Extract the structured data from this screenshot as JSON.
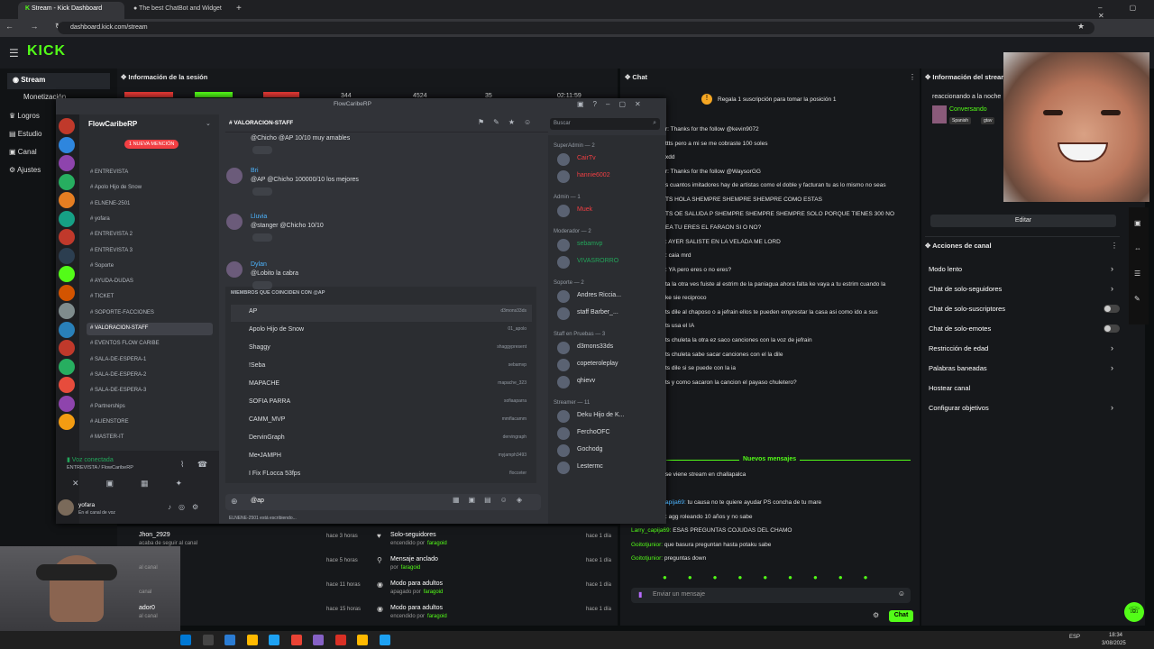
{
  "browser": {
    "tabs": [
      "Stream - Kick Dashboard",
      "The best ChatBot and Widget"
    ],
    "url": "dashboard.kick.com/stream"
  },
  "kick": {
    "logo": "KICK",
    "nav": [
      "Stream",
      "Monetización",
      "Logros",
      "Estudio",
      "Canal",
      "Ajustes"
    ],
    "session_title": "Información de la sesión",
    "stats": [
      "344",
      "4524",
      "35",
      "02:11:59"
    ],
    "chat_title": "Chat",
    "stream_info_title": "Información del stream",
    "accent": "#53fc18"
  },
  "discord": {
    "title": "FlowCaribeRP",
    "server": "FlowCaribeRP",
    "channel_header": "VALORACION-STAFF",
    "search_placeholder": "Buscar",
    "new_mention": "1 NUEVA MENCIÓN",
    "channels": [
      {
        "name": "ENTREVISTA",
        "sel": false
      },
      {
        "name": "Apolo Hijo de Snow",
        "sel": false
      },
      {
        "name": "ELNENE-2501",
        "sel": false
      },
      {
        "name": "yofara",
        "sel": false
      },
      {
        "name": "ENTREVISTA 2",
        "sel": false
      },
      {
        "name": "ENTREVISTA 3",
        "sel": false
      },
      {
        "name": "Soporte",
        "sel": false
      },
      {
        "name": "AYUDA-DUDAS",
        "sel": false
      },
      {
        "name": "TICKET",
        "sel": false
      },
      {
        "name": "SOPORTE-FACCIONES",
        "sel": false
      },
      {
        "name": "VALORACION-STAFF",
        "sel": true
      },
      {
        "name": "EVENTOS FLOW CARIBE",
        "sel": false
      },
      {
        "name": "SALA-DE-ESPERA-1",
        "sel": false
      },
      {
        "name": "SALA-DE-ESPERA-2",
        "sel": false
      },
      {
        "name": "SALA-DE-ESPERA-3",
        "sel": false
      },
      {
        "name": "Partnerships",
        "sel": false
      },
      {
        "name": "ALIENSTORE",
        "sel": false
      },
      {
        "name": "MASTER-IT",
        "sel": false
      }
    ],
    "voice_status": "Voz conectada",
    "voice_channel": "ENTREVISTA / FlowCaribeRP",
    "user": "yofara",
    "user_status": "En el canal de voz",
    "messages": [
      {
        "user": "",
        "text": "@Chicho @AP 10/10 muy amables"
      },
      {
        "user": "Bri",
        "text": "@AP @Chicho 100000/10 los mejores"
      },
      {
        "user": "Lluvia",
        "text": "@stanger @Chicho 10/10"
      },
      {
        "user": "Dylan",
        "text": "@Lobito la cabra"
      }
    ],
    "suggest_header": "MIEMBROS QUE COINCIDEN CON @AP",
    "suggestions": [
      {
        "name": "AP",
        "handle": "d3mons33ds"
      },
      {
        "name": "Apolo Hijo de Snow",
        "handle": "01_apolo"
      },
      {
        "name": "Shaggy",
        "handle": "shaggypresent"
      },
      {
        "name": "!Seba",
        "handle": "sebamvp"
      },
      {
        "name": "MAPACHE",
        "handle": "mapache_323"
      },
      {
        "name": "SOFIA PARRA",
        "handle": "sofiaaparra"
      },
      {
        "name": "CAMM_MVP",
        "handle": "mmflacamm"
      },
      {
        "name": "DervinGraph",
        "handle": "dervingraph"
      },
      {
        "name": "Me•JAMPH",
        "handle": "myjamph3493"
      },
      {
        "name": "I Fix FLocca 53fps",
        "handle": "flocceter"
      }
    ],
    "input_value": "@ap",
    "typing": "ELNENE-2501 está escribiendo...",
    "member_groups": [
      {
        "title": "SuperAdmin — 2",
        "members": [
          "CairTv",
          "hannie6002"
        ]
      },
      {
        "title": "Admin — 1",
        "members": [
          "Muek"
        ]
      },
      {
        "title": "Moderador — 2",
        "members": [
          "sebamvp",
          "VIVASRORRO"
        ]
      },
      {
        "title": "Soporte — 2",
        "members": [
          "Andres Riccia...",
          "staff Barber_..."
        ]
      },
      {
        "title": "Staff en Pruebas — 3",
        "members": [
          "d3mons33ds",
          "copeteroleplay",
          "qhievv"
        ]
      },
      {
        "title": "Streamer — 11",
        "members": [
          "Deku Hijo de K...",
          "FerchoOFC",
          "Gochodg",
          "Lestermc"
        ]
      }
    ]
  },
  "activity": {
    "left": [
      {
        "title": "Jhon_2929",
        "sub": "acaba de seguir al canal",
        "time": "hace 3 horas"
      },
      {
        "title": "",
        "sub": "al canal",
        "time": "hace 5 horas"
      },
      {
        "title": "",
        "sub": "canal",
        "time": "hace 11 horas"
      },
      {
        "title": "ador0",
        "sub": "al canal",
        "time": "hace 15 horas"
      }
    ],
    "right": [
      {
        "title": "Solo-seguidores",
        "sub": "encendido por",
        "by": "faragoid",
        "time": "hace 1 día"
      },
      {
        "title": "Mensaje anclado",
        "sub": "por",
        "by": "faragoid",
        "time": "hace 1 día"
      },
      {
        "title": "Modo para adultos",
        "sub": "apagado por",
        "by": "faragoid",
        "time": "hace 1 día"
      },
      {
        "title": "Modo para adultos",
        "sub": "encendido por",
        "by": "faragoid",
        "time": "hace 1 día"
      }
    ]
  },
  "chat": {
    "promo": "Regala 1 suscripción para tomar la posición 1",
    "lines": [
      {
        "name": "",
        "text": "r: Thanks for the follow @kevin9072"
      },
      {
        "name": "",
        "text": "ttts pero a mi se me cobraste 100 soles"
      },
      {
        "name": "",
        "text": "xdd"
      },
      {
        "name": "",
        "text": "r: Thanks for the follow @WaysorGG"
      },
      {
        "name": "",
        "text": "s cuantos imitadores hay de artistas como el doble y facturan tu as lo mismo no seas"
      },
      {
        "name": "",
        "text": "TS HOLA SHEMPRE SHEMPRE SHEMPRE COMO ESTAS"
      },
      {
        "name": "",
        "text": "TS OE SALUDA P SHEMPRE SHEMPRE SHEMPRE SOLO PORQUE TIENES 300 NO"
      },
      {
        "name": "",
        "text": "EA TU ERES EL FARAON SI O NO?"
      },
      {
        "name": "",
        "text": ": AYER SALISTE EN LA VELADA ME LORD"
      },
      {
        "name": "",
        "text": ": caia mrd"
      },
      {
        "name": "",
        "text": ": YA pero eres o no eres?"
      },
      {
        "name": "",
        "text": "ta la otra ves fuiste al estrim de la paniagua ahora falta ke vaya a tu estrim cuando la"
      },
      {
        "name": "",
        "text": "ke sie reciproco"
      },
      {
        "name": "",
        "text": "ts dile al chaposo o a jefrain ellos te pueden emprestar la casa asi como ido a sus"
      },
      {
        "name": "",
        "text": "ts usa el IA"
      },
      {
        "name": "",
        "text": "ts chuleta la otra ez saco canciones con la voz de jefrain"
      },
      {
        "name": "",
        "text": "ts chuleta sabe sacar canciones con el la dile"
      },
      {
        "name": "",
        "text": "ts dile si se puede con la ia"
      },
      {
        "name": "",
        "text": "ts y como sacaron la cancion el payaso chuletero?"
      }
    ],
    "new_messages": "Nuevos mensajes",
    "lines2": [
      {
        "name": "",
        "text": "se viene stream en challapalca"
      },
      {
        "name": "apija69:",
        "text": " tu causa no te quiere ayudar PS concha de tu mare"
      },
      {
        "name": "",
        "text": ": agg roleando 10 años y no sabe"
      },
      {
        "name": "Larry_capija69:",
        "text": " ESAS PREGUNTAS COJUDAS DEL CHAMO"
      },
      {
        "name": "Goitotjunior:",
        "text": " que basura preguntan hasta potaku sabe"
      },
      {
        "name": "Goitotjunior:",
        "text": " preguntas down"
      }
    ],
    "input_placeholder": "Enviar un mensaje",
    "send_label": "Chat"
  },
  "right": {
    "status": "reaccionando a la noche",
    "conv": "Conversando",
    "tags": [
      "Spanish",
      "gtav"
    ],
    "edit": "Editar",
    "actions_title": "Acciones de canal",
    "options": [
      {
        "label": "Modo lento",
        "kind": "arrow"
      },
      {
        "label": "Chat de solo-seguidores",
        "kind": "arrow"
      },
      {
        "label": "Chat de solo-suscriptores",
        "kind": "toggle"
      },
      {
        "label": "Chat de solo-emotes",
        "kind": "toggle"
      },
      {
        "label": "Restricción de edad",
        "kind": "arrow"
      },
      {
        "label": "Palabras baneadas",
        "kind": "arrow"
      },
      {
        "label": "Hostear canal",
        "kind": "none"
      },
      {
        "label": "Configurar objetivos",
        "kind": "arrow"
      }
    ]
  },
  "taskbar": {
    "lang": "ESP",
    "time": "18:34",
    "date": "3/08/2025"
  }
}
